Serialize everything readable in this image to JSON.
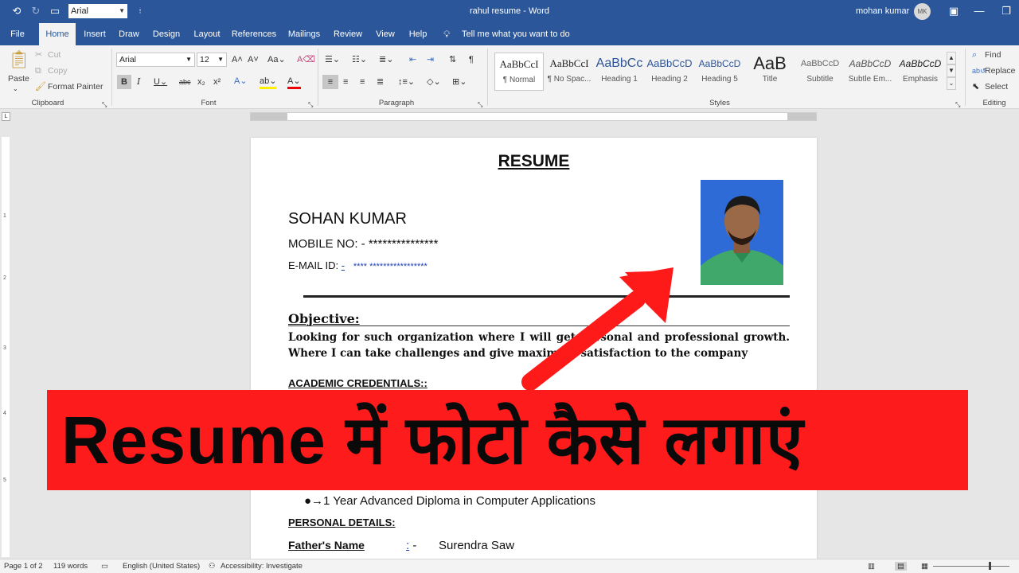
{
  "titlebar": {
    "font_box": "Arial",
    "doc_title": "rahul resume  -  Word",
    "user_name": "mohan kumar",
    "user_initials": "MK"
  },
  "tabs": [
    "File",
    "Home",
    "Insert",
    "Draw",
    "Design",
    "Layout",
    "References",
    "Mailings",
    "Review",
    "View",
    "Help"
  ],
  "active_tab": "Home",
  "tell_me": "Tell me what you want to do",
  "ribbon": {
    "clipboard": {
      "label": "Clipboard",
      "paste": "Paste",
      "cut": "Cut",
      "copy": "Copy",
      "format_painter": "Format Painter"
    },
    "font": {
      "label": "Font",
      "font_name": "Arial",
      "font_size": "12"
    },
    "paragraph": {
      "label": "Paragraph"
    },
    "styles": {
      "label": "Styles",
      "items": [
        {
          "preview": "AaBbCcI",
          "name": "¶ Normal"
        },
        {
          "preview": "AaBbCcI",
          "name": "¶ No Spac..."
        },
        {
          "preview": "AaBbCc",
          "name": "Heading 1"
        },
        {
          "preview": "AaBbCcD",
          "name": "Heading 2"
        },
        {
          "preview": "AaBbCcD",
          "name": "Heading 5"
        },
        {
          "preview": "AaB",
          "name": "Title"
        },
        {
          "preview": "AaBbCcD",
          "name": "Subtitle"
        },
        {
          "preview": "AaBbCcD",
          "name": "Subtle Em..."
        },
        {
          "preview": "AaBbCcD",
          "name": "Emphasis"
        }
      ]
    },
    "editing": {
      "label": "Editing",
      "find": "Find",
      "replace": "Replace",
      "select": "Select"
    }
  },
  "vruler_numbers": [
    "1",
    "2",
    "3",
    "4",
    "5"
  ],
  "document": {
    "heading": "RESUME",
    "name": "SOHAN KUMAR",
    "mobile": "MOBILE NO: - ***************",
    "email_label": "E-MAIL ID: ",
    "email_dash": "-",
    "email_value": "**** *****************",
    "objective_heading": "Objective:",
    "objective_text": "Looking for such organization where I will get personal and professional growth. Where I can take challenges and give maximum satisfaction to the company",
    "academic_heading": "ACADEMIC CREDENTIALS::",
    "bullet_1": "●→1 Year Advanced Diploma in Computer Applications",
    "personal_heading": "PERSONAL DETAILS:",
    "father_label": "Father's Name",
    "father_colon": ":",
    "father_dash": " -",
    "father_value": "Surendra Saw"
  },
  "banner": {
    "text": "Resume में फोटो कैसे लगाएं",
    "bg_color": "#fd1b1b"
  },
  "status": {
    "page": "Page 1 of 2",
    "words": "119 words",
    "language": "English (United States)",
    "accessibility": "Accessibility: Investigate"
  },
  "colors": {
    "title_blue": "#2b579a",
    "arrow_red": "#ff1a1a"
  }
}
